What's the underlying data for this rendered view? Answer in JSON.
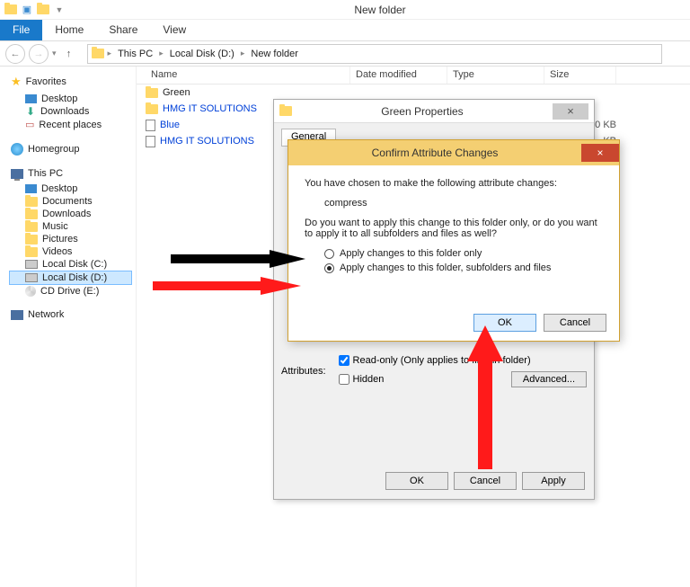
{
  "window": {
    "title": "New folder"
  },
  "ribbon": {
    "file": "File",
    "home": "Home",
    "share": "Share",
    "view": "View"
  },
  "breadcrumb": {
    "root": "This PC",
    "drive": "Local Disk (D:)",
    "folder": "New folder"
  },
  "sidebar": {
    "favorites": {
      "head": "Favorites",
      "items": [
        "Desktop",
        "Downloads",
        "Recent places"
      ]
    },
    "homegroup": "Homegroup",
    "thispc": {
      "head": "This PC",
      "items": [
        "Desktop",
        "Documents",
        "Downloads",
        "Music",
        "Pictures",
        "Videos",
        "Local Disk (C:)",
        "Local Disk (D:)",
        "CD Drive (E:)"
      ]
    },
    "network": "Network"
  },
  "columns": {
    "name": "Name",
    "date": "Date modified",
    "type": "Type",
    "size": "Size"
  },
  "files": [
    {
      "name": "Green",
      "kind": "folder",
      "compressed": false,
      "size": ""
    },
    {
      "name": "HMG IT SOLUTIONS",
      "kind": "folder",
      "compressed": true,
      "size": ""
    },
    {
      "name": "Blue",
      "kind": "file",
      "compressed": true,
      "size": "0 KB"
    },
    {
      "name": "HMG IT SOLUTIONS",
      "kind": "file",
      "compressed": true,
      "size": "KB"
    }
  ],
  "props": {
    "title": "Green Properties",
    "tabs": [
      "General"
    ],
    "attributes_label": "Attributes:",
    "readonly": "Read-only (Only applies to files in folder)",
    "hidden": "Hidden",
    "advanced": "Advanced...",
    "ok": "OK",
    "cancel": "Cancel",
    "apply": "Apply"
  },
  "confirm": {
    "title": "Confirm Attribute Changes",
    "line1": "You have chosen to make the following attribute changes:",
    "change": "compress",
    "line2": "Do you want to apply this change to this folder only, or do you want to apply it to all subfolders and files as well?",
    "opt1": "Apply changes to this folder only",
    "opt2": "Apply changes to this folder, subfolders and files",
    "ok": "OK",
    "cancel": "Cancel"
  }
}
